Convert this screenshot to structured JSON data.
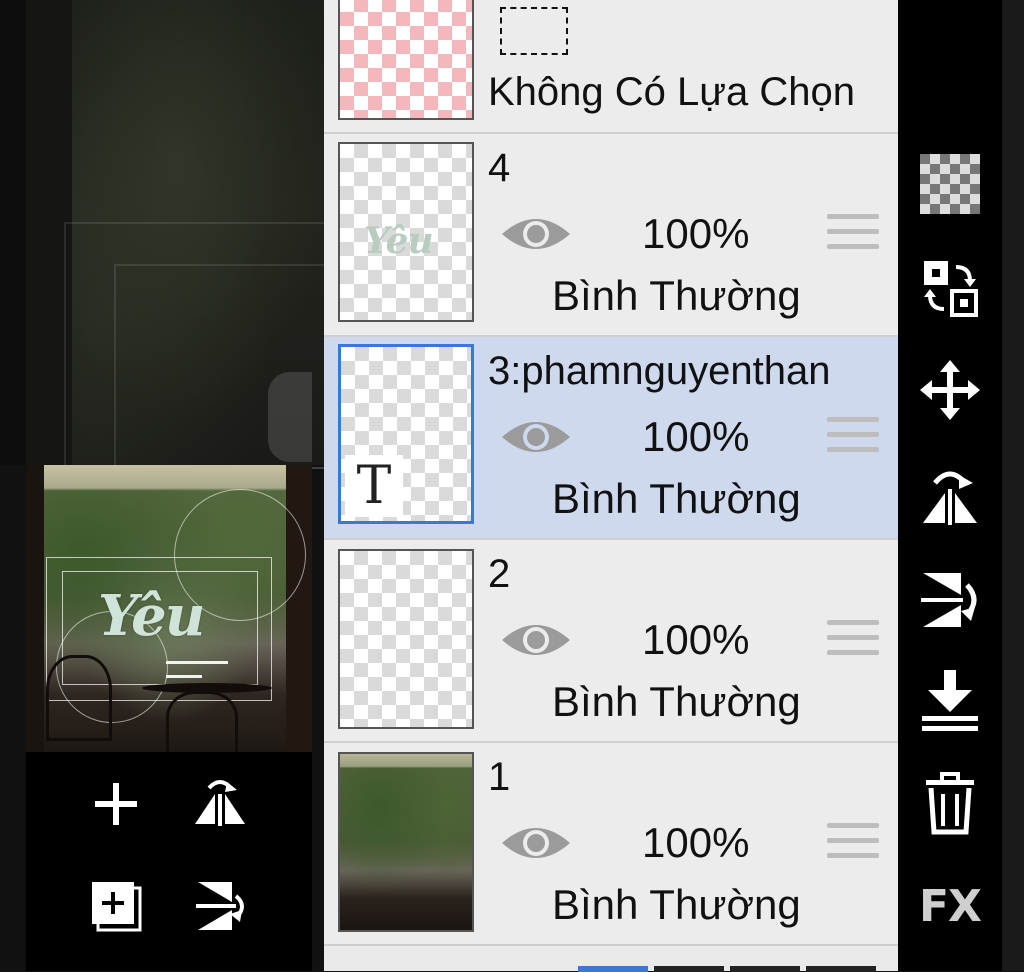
{
  "selection_layer": {
    "label": "Không Có Lựa Chọn"
  },
  "layers": [
    {
      "name": "4",
      "opacity": "100%",
      "blend_mode": "Bình Thường",
      "thumb_text": "Yêu"
    },
    {
      "name": "3:phamnguyenthan",
      "opacity": "100%",
      "blend_mode": "Bình Thường",
      "type_badge": "T"
    },
    {
      "name": "2",
      "opacity": "100%",
      "blend_mode": "Bình Thường"
    },
    {
      "name": "1",
      "opacity": "100%",
      "blend_mode": "Bình Thường"
    }
  ],
  "preview": {
    "title_text": "Yêu"
  },
  "right_toolbar": {
    "fx_label": "FX"
  },
  "colors": {
    "selected_row": "#cfd9ee",
    "selected_border": "#3a78d6",
    "toolbar_bg": "#000000",
    "panel_bg": "#ececec"
  }
}
